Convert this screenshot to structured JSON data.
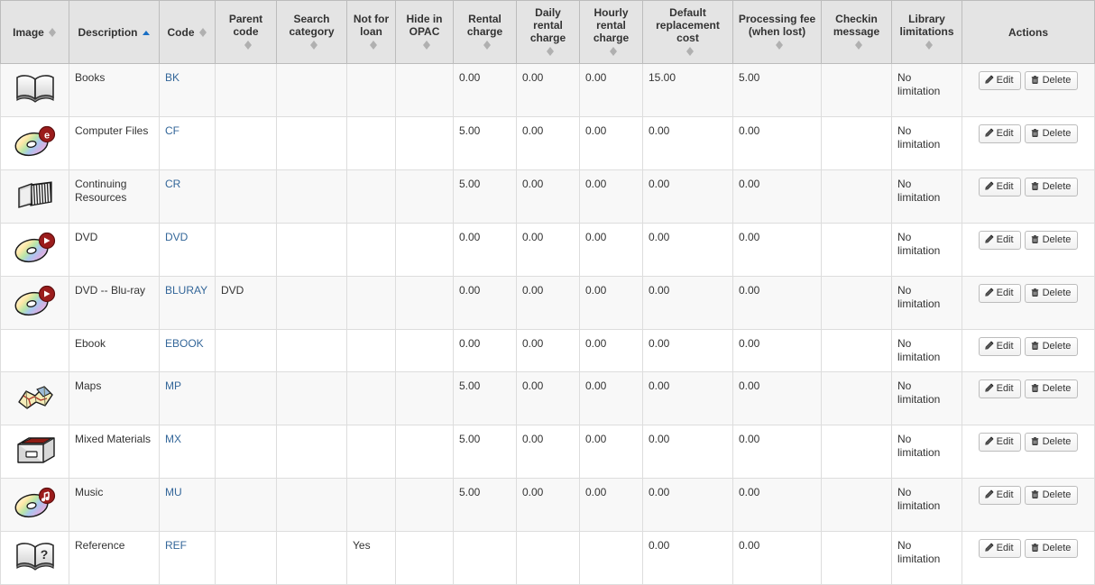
{
  "table": {
    "columns": [
      {
        "label": "Image",
        "sortable": true,
        "sort": "none"
      },
      {
        "label": "Description",
        "sortable": true,
        "sort": "asc"
      },
      {
        "label": "Code",
        "sortable": true,
        "sort": "none"
      },
      {
        "label": "Parent code",
        "sortable": true,
        "sort": "none"
      },
      {
        "label": "Search category",
        "sortable": true,
        "sort": "none"
      },
      {
        "label": "Not for loan",
        "sortable": true,
        "sort": "none"
      },
      {
        "label": "Hide in OPAC",
        "sortable": true,
        "sort": "none"
      },
      {
        "label": "Rental charge",
        "sortable": true,
        "sort": "none"
      },
      {
        "label": "Daily rental charge",
        "sortable": true,
        "sort": "none"
      },
      {
        "label": "Hourly rental charge",
        "sortable": true,
        "sort": "none"
      },
      {
        "label": "Default replacement cost",
        "sortable": true,
        "sort": "none"
      },
      {
        "label": "Processing fee (when lost)",
        "sortable": true,
        "sort": "none"
      },
      {
        "label": "Checkin message",
        "sortable": true,
        "sort": "none"
      },
      {
        "label": "Library limitations",
        "sortable": true,
        "sort": "none"
      },
      {
        "label": "Actions",
        "sortable": false,
        "sort": "none"
      }
    ],
    "rows": [
      {
        "icon": "open-book-icon",
        "description": "Books",
        "code": "BK",
        "parent_code": "",
        "search_category": "",
        "not_for_loan": "",
        "hide_in_opac": "",
        "rental_charge": "0.00",
        "daily_rental_charge": "0.00",
        "hourly_rental_charge": "0.00",
        "default_replacement_cost": "15.00",
        "processing_fee": "5.00",
        "checkin_message": "",
        "library_limitations": "No limitation",
        "edit_label": "Edit",
        "delete_label": "Delete"
      },
      {
        "icon": "cd-ebook-icon",
        "description": "Computer Files",
        "code": "CF",
        "parent_code": "",
        "search_category": "",
        "not_for_loan": "",
        "hide_in_opac": "",
        "rental_charge": "5.00",
        "daily_rental_charge": "0.00",
        "hourly_rental_charge": "0.00",
        "default_replacement_cost": "0.00",
        "processing_fee": "0.00",
        "checkin_message": "",
        "library_limitations": "No limitation",
        "edit_label": "Edit",
        "delete_label": "Delete"
      },
      {
        "icon": "serials-icon",
        "description": "Continuing Resources",
        "code": "CR",
        "parent_code": "",
        "search_category": "",
        "not_for_loan": "",
        "hide_in_opac": "",
        "rental_charge": "5.00",
        "daily_rental_charge": "0.00",
        "hourly_rental_charge": "0.00",
        "default_replacement_cost": "0.00",
        "processing_fee": "0.00",
        "checkin_message": "",
        "library_limitations": "No limitation",
        "edit_label": "Edit",
        "delete_label": "Delete"
      },
      {
        "icon": "dvd-icon",
        "description": "DVD",
        "code": "DVD",
        "parent_code": "",
        "search_category": "",
        "not_for_loan": "",
        "hide_in_opac": "",
        "rental_charge": "0.00",
        "daily_rental_charge": "0.00",
        "hourly_rental_charge": "0.00",
        "default_replacement_cost": "0.00",
        "processing_fee": "0.00",
        "checkin_message": "",
        "library_limitations": "No limitation",
        "edit_label": "Edit",
        "delete_label": "Delete"
      },
      {
        "icon": "dvd-icon",
        "description": "DVD -- Blu-ray",
        "code": "BLURAY",
        "parent_code": "DVD",
        "search_category": "",
        "not_for_loan": "",
        "hide_in_opac": "",
        "rental_charge": "0.00",
        "daily_rental_charge": "0.00",
        "hourly_rental_charge": "0.00",
        "default_replacement_cost": "0.00",
        "processing_fee": "0.00",
        "checkin_message": "",
        "library_limitations": "No limitation",
        "edit_label": "Edit",
        "delete_label": "Delete"
      },
      {
        "icon": "none",
        "description": "Ebook",
        "code": "EBOOK",
        "parent_code": "",
        "search_category": "",
        "not_for_loan": "",
        "hide_in_opac": "",
        "rental_charge": "0.00",
        "daily_rental_charge": "0.00",
        "hourly_rental_charge": "0.00",
        "default_replacement_cost": "0.00",
        "processing_fee": "0.00",
        "checkin_message": "",
        "library_limitations": "No limitation",
        "edit_label": "Edit",
        "delete_label": "Delete"
      },
      {
        "icon": "map-icon",
        "description": "Maps",
        "code": "MP",
        "parent_code": "",
        "search_category": "",
        "not_for_loan": "",
        "hide_in_opac": "",
        "rental_charge": "5.00",
        "daily_rental_charge": "0.00",
        "hourly_rental_charge": "0.00",
        "default_replacement_cost": "0.00",
        "processing_fee": "0.00",
        "checkin_message": "",
        "library_limitations": "No limitation",
        "edit_label": "Edit",
        "delete_label": "Delete"
      },
      {
        "icon": "box-icon",
        "description": "Mixed Materials",
        "code": "MX",
        "parent_code": "",
        "search_category": "",
        "not_for_loan": "",
        "hide_in_opac": "",
        "rental_charge": "5.00",
        "daily_rental_charge": "0.00",
        "hourly_rental_charge": "0.00",
        "default_replacement_cost": "0.00",
        "processing_fee": "0.00",
        "checkin_message": "",
        "library_limitations": "No limitation",
        "edit_label": "Edit",
        "delete_label": "Delete"
      },
      {
        "icon": "cd-music-icon",
        "description": "Music",
        "code": "MU",
        "parent_code": "",
        "search_category": "",
        "not_for_loan": "",
        "hide_in_opac": "",
        "rental_charge": "5.00",
        "daily_rental_charge": "0.00",
        "hourly_rental_charge": "0.00",
        "default_replacement_cost": "0.00",
        "processing_fee": "0.00",
        "checkin_message": "",
        "library_limitations": "No limitation",
        "edit_label": "Edit",
        "delete_label": "Delete"
      },
      {
        "icon": "reference-book-icon",
        "description": "Reference",
        "code": "REF",
        "parent_code": "",
        "search_category": "",
        "not_for_loan": "Yes",
        "hide_in_opac": "",
        "rental_charge": "",
        "daily_rental_charge": "",
        "hourly_rental_charge": "",
        "default_replacement_cost": "0.00",
        "processing_fee": "0.00",
        "checkin_message": "",
        "library_limitations": "No limitation",
        "edit_label": "Edit",
        "delete_label": "Delete"
      }
    ]
  },
  "colors": {
    "header_bg": "#e4e4e4",
    "link": "#336699",
    "sort_active": "#1a6fc4",
    "border": "#bcbcbc",
    "row_odd": "#f8f8f8",
    "text": "#333333"
  }
}
